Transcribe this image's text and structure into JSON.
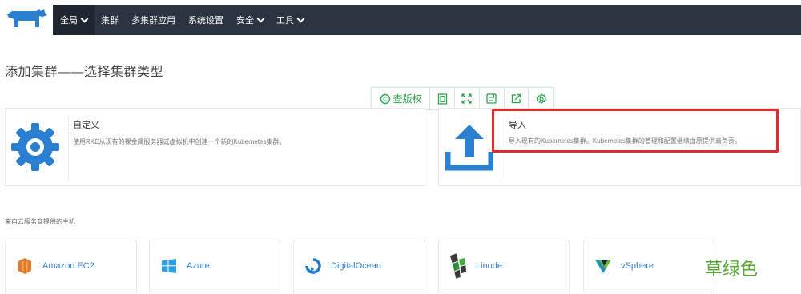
{
  "nav": {
    "items": [
      {
        "label": "全局",
        "dropdown": true,
        "active": true
      },
      {
        "label": "集群",
        "dropdown": false
      },
      {
        "label": "多集群应用",
        "dropdown": false
      },
      {
        "label": "系统设置",
        "dropdown": false
      },
      {
        "label": "安全",
        "dropdown": true
      },
      {
        "label": "工具",
        "dropdown": true
      }
    ],
    "background": "#2b3440",
    "logo_icon": "rancher-cow-logo"
  },
  "page": {
    "title": "添加集群——选择集群类型"
  },
  "toolbar": {
    "copyright_label": "查版权",
    "icons": [
      "copyright-icon",
      "page-icon",
      "fullscreen-icon",
      "save-icon",
      "share-icon",
      "settings-icon"
    ],
    "accent": "#2aa54a"
  },
  "cards": {
    "custom": {
      "title": "自定义",
      "desc": "使用RKE从现有的裸金属服务器或虚拟机中创建一个新的Kubernetes集群。",
      "icon": "gear-icon"
    },
    "import": {
      "title": "导入",
      "desc": "导入现有的Kubernetes集群。Kubernetes集群的管理和配置继续由原提供商负责。",
      "icon": "upload-icon"
    }
  },
  "highlight_color": "#e02b2b",
  "providers": {
    "section_label": "来自云服务商提供的主机",
    "items": [
      {
        "label": "Amazon EC2",
        "icon": "amazon-ec2-icon"
      },
      {
        "label": "Azure",
        "icon": "azure-icon"
      },
      {
        "label": "DigitalOcean",
        "icon": "digitalocean-icon"
      },
      {
        "label": "Linode",
        "icon": "linode-icon"
      },
      {
        "label": "vSphere",
        "icon": "vsphere-icon"
      }
    ]
  },
  "watermark": {
    "text": "草绿色",
    "color": "#57a830"
  }
}
